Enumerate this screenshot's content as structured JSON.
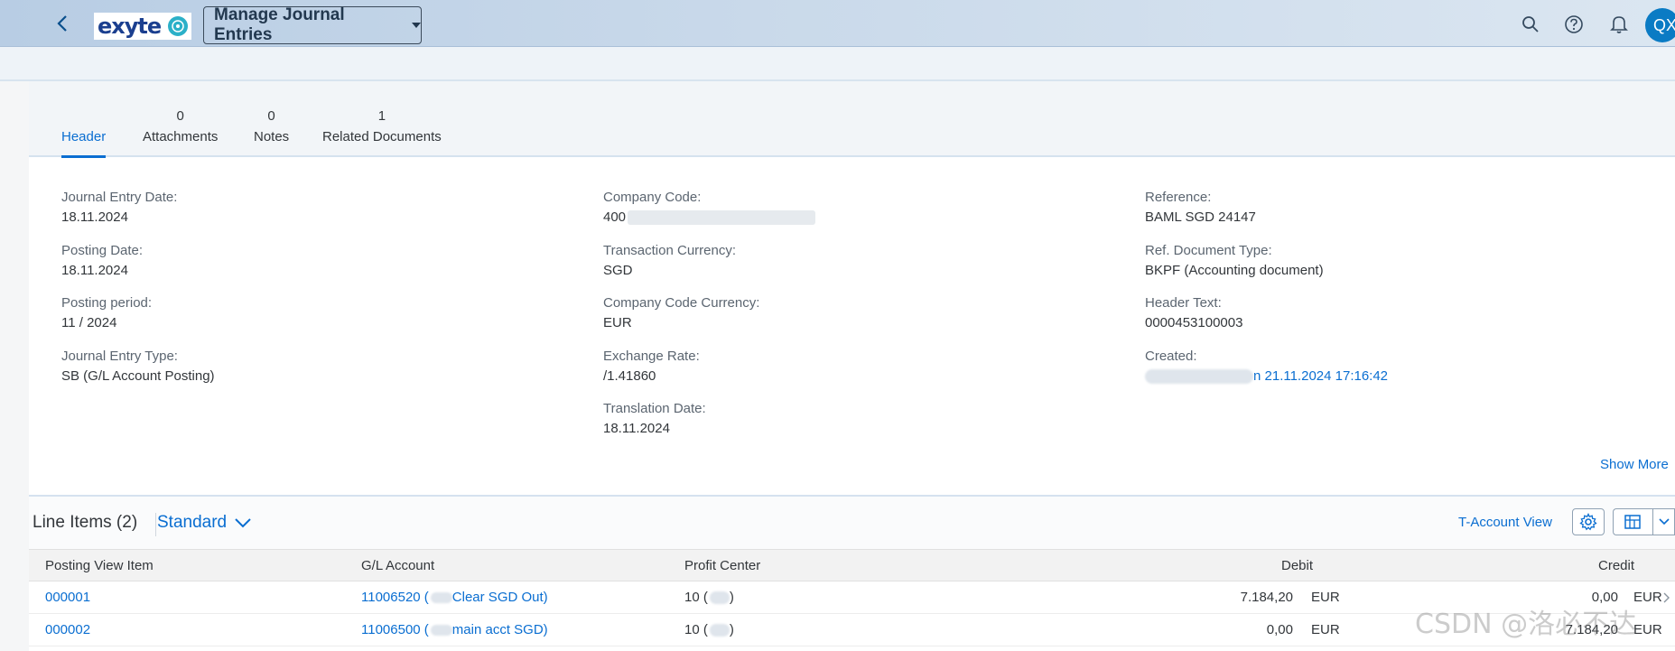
{
  "shell": {
    "logo_text": "exyte",
    "app_title": "Manage Journal Entries",
    "avatar_initials": "QX",
    "icons": [
      "back-icon",
      "search-icon",
      "help-icon",
      "notification-icon"
    ]
  },
  "tabs": [
    {
      "count": "",
      "label": "Header"
    },
    {
      "count": "0",
      "label": "Attachments"
    },
    {
      "count": "0",
      "label": "Notes"
    },
    {
      "count": "1",
      "label": "Related Documents"
    }
  ],
  "header": {
    "col1": [
      {
        "label": "Journal Entry Date:",
        "value": "18.11.2024"
      },
      {
        "label": "Posting Date:",
        "value": "18.11.2024"
      },
      {
        "label": "Posting period:",
        "value": "11 / 2024"
      },
      {
        "label": "Journal Entry Type:",
        "value": "SB (G/L Account Posting)"
      }
    ],
    "col2": [
      {
        "label": "Company Code:",
        "value": "400"
      },
      {
        "label": "Transaction Currency:",
        "value": "SGD"
      },
      {
        "label": "Company Code Currency:",
        "value": "EUR"
      },
      {
        "label": "Exchange Rate:",
        "value": "/1.41860"
      },
      {
        "label": "Translation Date:",
        "value": "18.11.2024"
      }
    ],
    "col3": [
      {
        "label": "Reference:",
        "value": "BAML SGD 24147"
      },
      {
        "label": "Ref. Document Type:",
        "value": "BKPF (Accounting document)"
      },
      {
        "label": "Header Text:",
        "value": "0000453100003"
      },
      {
        "label": "Created:",
        "value": "n 21.11.2024 17:16:42"
      }
    ],
    "show_more": "Show More"
  },
  "line_items": {
    "title": "Line Items (2)",
    "variant": "Standard",
    "t_account_view": "T-Account View",
    "columns": [
      "Posting View Item",
      "G/L Account",
      "Profit Center",
      "Debit",
      "Credit"
    ],
    "rows": [
      {
        "item": "000001",
        "account_num": "11006520 (",
        "account_name": " Clear SGD Out)",
        "profit_center": "10 (",
        "profit_center_end": ")",
        "debit": "7.184,20",
        "debit_cur": "EUR",
        "credit": "0,00",
        "credit_cur": "EUR"
      },
      {
        "item": "000002",
        "account_num": "11006500 (",
        "account_name": " main acct SGD)",
        "profit_center": "10 (",
        "profit_center_end": ")",
        "debit": "0,00",
        "debit_cur": "EUR",
        "credit": "7.184,20",
        "credit_cur": "EUR"
      }
    ]
  },
  "watermark": "CSDN @洛必不达"
}
